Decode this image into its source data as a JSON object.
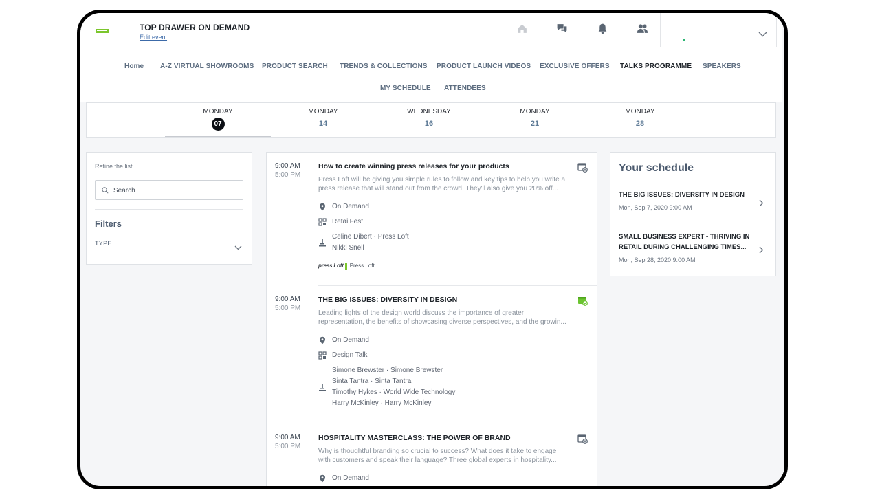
{
  "header": {
    "event_title": "TOP DRAWER ON DEMAND",
    "edit_event": "Edit event",
    "icons": [
      "home-icon",
      "chat-icon",
      "bell-icon",
      "people-icon",
      "chevron-down-icon"
    ]
  },
  "nav": {
    "row1": [
      "Home",
      "A-Z VIRTUAL SHOWROOMS",
      "PRODUCT SEARCH",
      "TRENDS & COLLECTIONS",
      "PRODUCT LAUNCH VIDEOS",
      "EXCLUSIVE OFFERS",
      "TALKS PROGRAMME",
      "SPEAKERS"
    ],
    "row2": [
      "MY SCHEDULE",
      "ATTENDEES"
    ],
    "active": "TALKS PROGRAMME"
  },
  "dates": [
    {
      "dow": "MONDAY",
      "day": "07",
      "active": true
    },
    {
      "dow": "MONDAY",
      "day": "14"
    },
    {
      "dow": "WEDNESDAY",
      "day": "16"
    },
    {
      "dow": "MONDAY",
      "day": "21"
    },
    {
      "dow": "MONDAY",
      "day": "28"
    }
  ],
  "refine": {
    "label": "Refine the list",
    "search_placeholder": "Search",
    "filters_title": "Filters",
    "type_label": "TYPE"
  },
  "sessions": [
    {
      "start": "9:00 AM",
      "end": "5:00 PM",
      "title": "How to create winning press releases for your products",
      "desc_line1": "Press Loft will be giving you simple rules to follow and key tips to help you write a",
      "desc_line2": "press release that will stand out from the crowd. They'll also give you 20% off...",
      "location": "On Demand",
      "category": "RetailFest",
      "speakers": [
        "Celine Dibert · Press Loft",
        "Nikki Snell"
      ],
      "sponsor_mark": "press Loft",
      "sponsor_name": "Press Loft",
      "in_schedule": false
    },
    {
      "start": "9:00 AM",
      "end": "5:00 PM",
      "title": "THE BIG ISSUES: DIVERSITY IN DESIGN",
      "desc_line1": "Leading lights of the design world discuss the importance of greater",
      "desc_line2": "representation, the benefits of showcasing diverse perspectives, and the growin...",
      "location": "On Demand",
      "category": "Design Talk",
      "speakers": [
        "Simone Brewster · Simone Brewster",
        "Sinta Tantra · Sinta Tantra",
        "Timothy Hykes · World Wide Technology",
        "Harry McKinley · Harry McKinley"
      ],
      "in_schedule": true
    },
    {
      "start": "9:00 AM",
      "end": "5:00 PM",
      "title": "HOSPITALITY MASTERCLASS: THE POWER OF BRAND",
      "desc_line1": "Why is thoughtful branding so crucial to success? What does it take to engage",
      "desc_line2": "with customers and speak their language? Three global experts in hospitality...",
      "location": "On Demand",
      "in_schedule": false
    }
  ],
  "schedule": {
    "title": "Your schedule",
    "items": [
      {
        "title": "THE BIG ISSUES: DIVERSITY IN DESIGN",
        "date": "Mon, Sep 7, 2020 9:00 AM"
      },
      {
        "title_line1": "SMALL BUSINESS EXPERT - THRIVING IN",
        "title_line2": "RETAIL DURING CHALLENGING TIMES...",
        "date": "Mon, Sep 28, 2020 9:00 AM"
      }
    ]
  },
  "colors": {
    "accent_green": "#7cc62d",
    "nav_text": "#5d6d80",
    "date_number": "#5d7a96",
    "added_icon": "#6cc431"
  }
}
